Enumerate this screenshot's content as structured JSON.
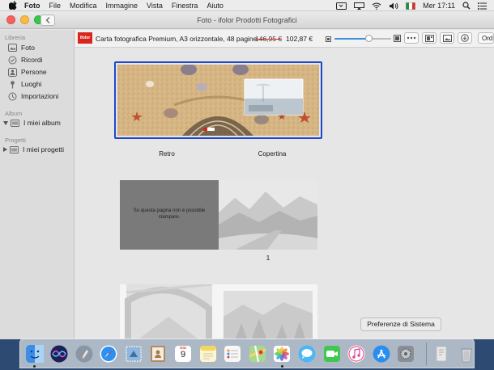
{
  "menubar": {
    "apple_icon": "apple-logo-icon",
    "items": [
      "Foto",
      "File",
      "Modifica",
      "Immagine",
      "Vista",
      "Finestra",
      "Aiuto"
    ],
    "active_app": "Foto",
    "status_icons": [
      "media-controls-icon",
      "airplay-display-icon",
      "wifi-icon",
      "volume-icon",
      "language-flag-icon",
      "spotlight-search-icon",
      "notification-list-icon"
    ],
    "clock": "Mer 17:11"
  },
  "window": {
    "title": "Foto - ifolor Prodotti Fotografici",
    "back_icon": "chevron-left-icon"
  },
  "sidebar": {
    "libreria_header": "Libreria",
    "library_items": [
      {
        "label": "Foto",
        "icon": "photos-icon"
      },
      {
        "label": "Ricordi",
        "icon": "memories-icon"
      },
      {
        "label": "Persone",
        "icon": "people-icon"
      },
      {
        "label": "Luoghi",
        "icon": "places-pin-icon"
      },
      {
        "label": "Importazioni",
        "icon": "imports-clock-icon"
      }
    ],
    "album_header": "Album",
    "album_item": "I miei album",
    "projects_header": "Progetti",
    "projects_item": "I miei progetti"
  },
  "toolbar": {
    "logo_text": "ifolor",
    "product_name": "Carta fotografica Premium, A3 orizzontale, 48 pagine",
    "price_old": "146,95 €",
    "price_new": "102,87 €",
    "zoom_level": 0.6,
    "order_label": "Ord",
    "accent": "#3d8fe0"
  },
  "book": {
    "cover_left_label": "Retro",
    "cover_right_label": "Copertina",
    "cover_logo_text": "ifolor",
    "unprintable_notice": "Su questa pagina non è possibile stampare.",
    "spread_1_label": "1"
  },
  "tooltip": "Preferenze di Sistema",
  "dock": {
    "apps": [
      {
        "name": "finder-icon",
        "color": "#3b8ee8",
        "running": true
      },
      {
        "name": "siri-icon",
        "color": "#2b2f7a",
        "running": false
      },
      {
        "name": "launchpad-icon",
        "color": "#8b96a5",
        "running": false
      },
      {
        "name": "safari-icon",
        "color": "#2d8ff0",
        "running": false
      },
      {
        "name": "mail-stamp-icon",
        "color": "#8fb6dc",
        "running": false
      },
      {
        "name": "contacts-icon",
        "color": "#b48a5a",
        "running": false
      },
      {
        "name": "calendar-icon",
        "color": "#ffffff",
        "running": false
      },
      {
        "name": "notes-icon",
        "color": "#f5e27a",
        "running": false
      },
      {
        "name": "reminders-icon",
        "color": "#f2f2f2",
        "running": false
      },
      {
        "name": "maps-icon",
        "color": "#7cc576",
        "running": false
      },
      {
        "name": "photos-icon",
        "color": "#ffffff",
        "running": true
      },
      {
        "name": "messages-icon",
        "color": "#4db6f5",
        "running": false
      },
      {
        "name": "facetime-icon",
        "color": "#3fc84f",
        "running": false
      },
      {
        "name": "itunes-icon",
        "color": "#f35a8c",
        "running": false
      },
      {
        "name": "app-store-icon",
        "color": "#2a8ef0",
        "running": false
      },
      {
        "name": "system-preferences-icon",
        "color": "#8a8f96",
        "running": false
      }
    ],
    "calendar_month": "GIU",
    "calendar_day": "9",
    "trailing": [
      {
        "name": "downloads-stack-icon",
        "color": "#e8e8e8"
      },
      {
        "name": "trash-icon",
        "color": "#cfd3d8"
      }
    ]
  }
}
